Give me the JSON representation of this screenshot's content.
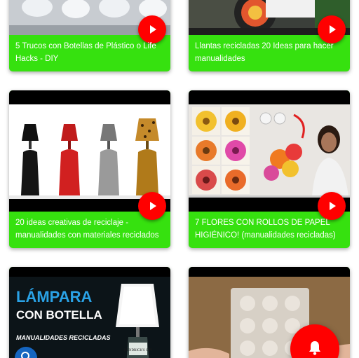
{
  "videos": [
    {
      "title": "5 Trucos con Botellas de Plástico o Life Hacks - DIY"
    },
    {
      "title": "Llantas recicladas 20 Ideas para hacer manualidades"
    },
    {
      "title": "20 ideas creativas de reciclaje - manualidades con materiales reciclados"
    },
    {
      "title": "7 FLORES CON ROLLOS DE PAPEL HIGIÉNICO! (manualidades recicladas)"
    },
    {
      "thumb_title_line1": "LÁMPARA",
      "thumb_title_line2": "CON BOTELLA",
      "thumb_subtitle": "MANUALIDADES RECICLADAS",
      "bottle_label": "HENDRICK'S GIN"
    },
    {}
  ],
  "colors": {
    "card_bg": "#36e10f",
    "play_button": "#ff0000",
    "notify_fab": "#ff0000",
    "search_fab": "#1565c0"
  },
  "icons": {
    "play": "play-icon",
    "notify": "bell-icon",
    "search": "search-icon"
  }
}
